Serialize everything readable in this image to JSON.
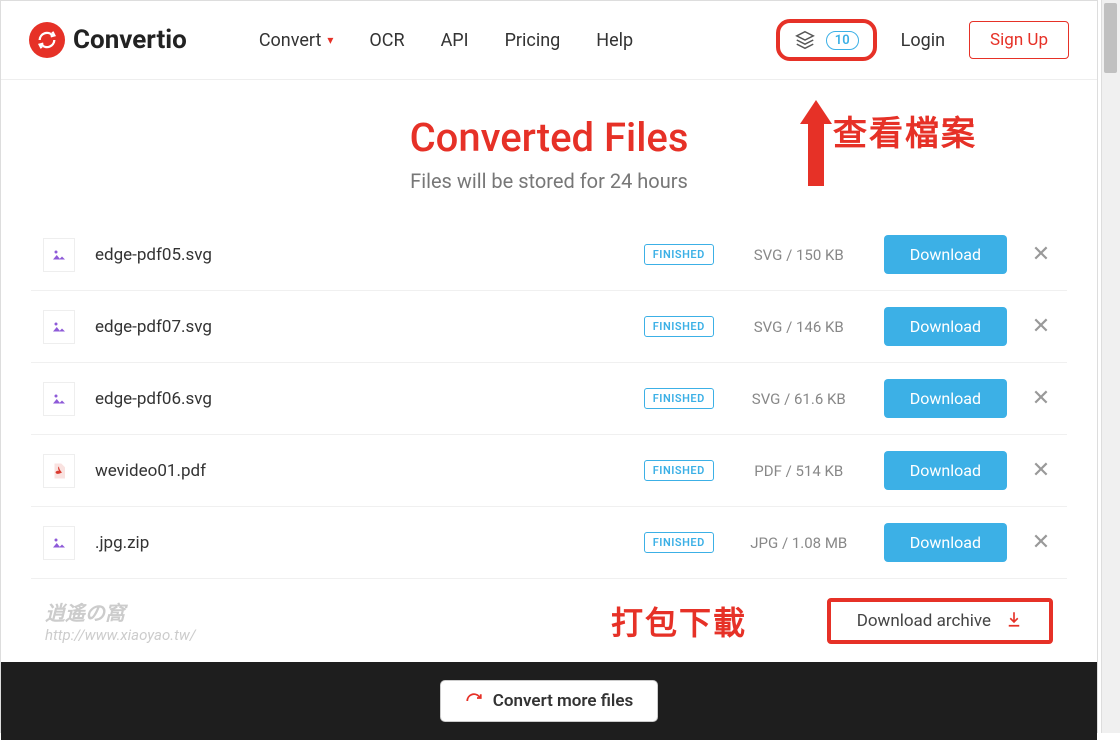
{
  "brand": {
    "name": "Convertio"
  },
  "nav": {
    "convert": "Convert",
    "ocr": "OCR",
    "api": "API",
    "pricing": "Pricing",
    "help": "Help"
  },
  "controls": {
    "queue_count": "10",
    "login": "Login",
    "signup": "Sign Up"
  },
  "hero": {
    "title": "Converted Files",
    "subtitle": "Files will be stored for 24 hours"
  },
  "annotations": {
    "view_files": "查看檔案",
    "download_pack": "打包下載"
  },
  "files": [
    {
      "icon": "image",
      "name": "edge-pdf05.svg",
      "status": "FINISHED",
      "meta": "SVG / 150 KB",
      "action": "Download"
    },
    {
      "icon": "image",
      "name": "edge-pdf07.svg",
      "status": "FINISHED",
      "meta": "SVG / 146 KB",
      "action": "Download"
    },
    {
      "icon": "image",
      "name": "edge-pdf06.svg",
      "status": "FINISHED",
      "meta": "SVG / 61.6 KB",
      "action": "Download"
    },
    {
      "icon": "pdf",
      "name": "wevideo01.pdf",
      "status": "FINISHED",
      "meta": "PDF / 514 KB",
      "action": "Download"
    },
    {
      "icon": "image",
      "name": ".jpg.zip",
      "status": "FINISHED",
      "meta": "JPG / 1.08 MB",
      "action": "Download"
    }
  ],
  "archive": {
    "label": "Download archive"
  },
  "footer": {
    "convert_more": "Convert more files"
  },
  "watermark": {
    "top": "逍遙の窩",
    "bottom": "http://www.xiaoyao.tw/"
  }
}
